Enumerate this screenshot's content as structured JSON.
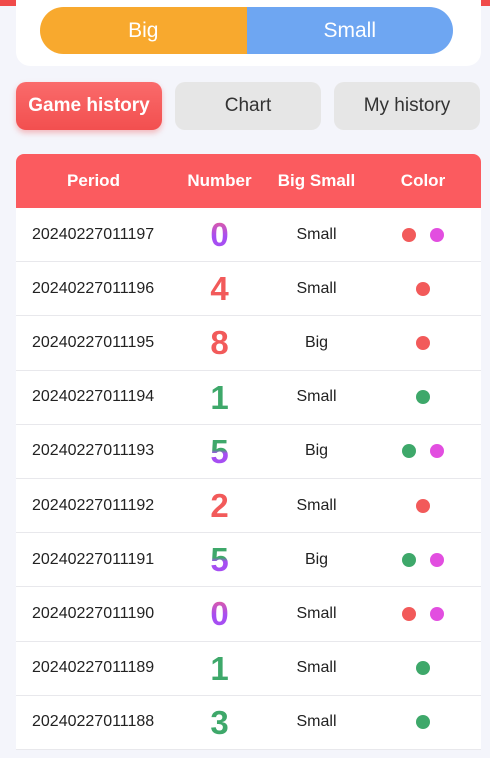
{
  "toggle": {
    "big_label": "Big",
    "small_label": "Small",
    "big_color": "#f8a92e",
    "small_color": "#6ea6f2"
  },
  "tabs": [
    {
      "label": "Game history",
      "active": true
    },
    {
      "label": "Chart",
      "active": false
    },
    {
      "label": "My history",
      "active": false
    }
  ],
  "table": {
    "headers": {
      "period": "Period",
      "number": "Number",
      "big_small": "Big Small",
      "color": "Color"
    },
    "colors": {
      "red": "#f25a5a",
      "green": "#3ea86a",
      "violet": "#e24ee0"
    },
    "rows": [
      {
        "period": "20240227011197",
        "number": "0",
        "number_style": "violet",
        "big_small": "Small",
        "colors": [
          "red",
          "violet"
        ]
      },
      {
        "period": "20240227011196",
        "number": "4",
        "number_style": "red",
        "big_small": "Small",
        "colors": [
          "red"
        ]
      },
      {
        "period": "20240227011195",
        "number": "8",
        "number_style": "red",
        "big_small": "Big",
        "colors": [
          "red"
        ]
      },
      {
        "period": "20240227011194",
        "number": "1",
        "number_style": "green",
        "big_small": "Small",
        "colors": [
          "green"
        ]
      },
      {
        "period": "20240227011193",
        "number": "5",
        "number_style": "green-violet",
        "big_small": "Big",
        "colors": [
          "green",
          "violet"
        ]
      },
      {
        "period": "20240227011192",
        "number": "2",
        "number_style": "red",
        "big_small": "Small",
        "colors": [
          "red"
        ]
      },
      {
        "period": "20240227011191",
        "number": "5",
        "number_style": "green-violet",
        "big_small": "Big",
        "colors": [
          "green",
          "violet"
        ]
      },
      {
        "period": "20240227011190",
        "number": "0",
        "number_style": "violet",
        "big_small": "Small",
        "colors": [
          "red",
          "violet"
        ]
      },
      {
        "period": "20240227011189",
        "number": "1",
        "number_style": "green",
        "big_small": "Small",
        "colors": [
          "green"
        ]
      },
      {
        "period": "20240227011188",
        "number": "3",
        "number_style": "green",
        "big_small": "Small",
        "colors": [
          "green"
        ]
      }
    ]
  }
}
